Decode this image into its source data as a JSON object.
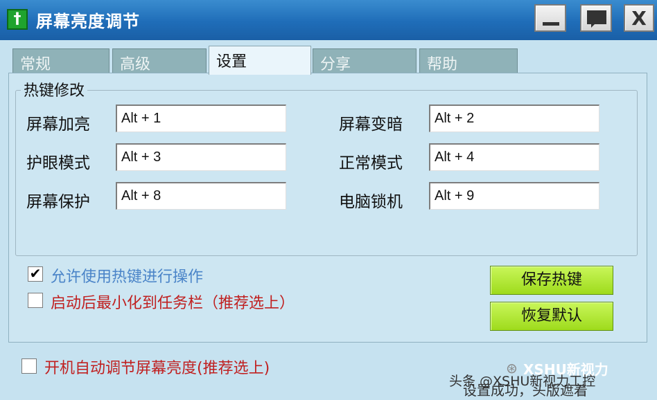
{
  "window": {
    "title": "屏幕亮度调节",
    "minimize_icon": "minimize-icon",
    "maximize_icon": "chat-icon",
    "close_label": "X"
  },
  "tabs": [
    {
      "label": "常规",
      "active": false
    },
    {
      "label": "高级",
      "active": false
    },
    {
      "label": "设置",
      "active": true
    },
    {
      "label": "分享",
      "active": false
    },
    {
      "label": "帮助",
      "active": false
    }
  ],
  "hotkeys": {
    "group_title": "热键修改",
    "items": [
      {
        "label": "屏幕加亮",
        "value": "Alt + 1"
      },
      {
        "label": "屏幕变暗",
        "value": "Alt + 2"
      },
      {
        "label": "护眼模式",
        "value": "Alt + 3"
      },
      {
        "label": "正常模式",
        "value": "Alt + 4"
      },
      {
        "label": "屏幕保护",
        "value": "Alt + 8"
      },
      {
        "label": "电脑锁机",
        "value": "Alt + 9"
      }
    ]
  },
  "options": {
    "allow_hotkeys": {
      "label": "允许使用热键进行操作",
      "checked": true
    },
    "minimize_to_tray": {
      "label": "启动后最小化到任务栏（推荐选上）",
      "checked": false
    },
    "auto_adjust": {
      "label": "开机自动调节屏幕亮度(推荐选上)",
      "checked": false
    }
  },
  "buttons": {
    "save": "保存热键",
    "restore": "恢复默认"
  },
  "footer": {
    "watermark": "头条 @XSHU新视力工控",
    "brand": "XSHU新视力",
    "status": "设置成功，头版遮着"
  },
  "colors": {
    "titlebar": "#1f6db8",
    "tab_inactive": "#8fb2b8",
    "panel": "#cde6f2",
    "button_green": "#9edb1c",
    "text_blue": "#4a84c8",
    "text_red": "#c02020"
  }
}
